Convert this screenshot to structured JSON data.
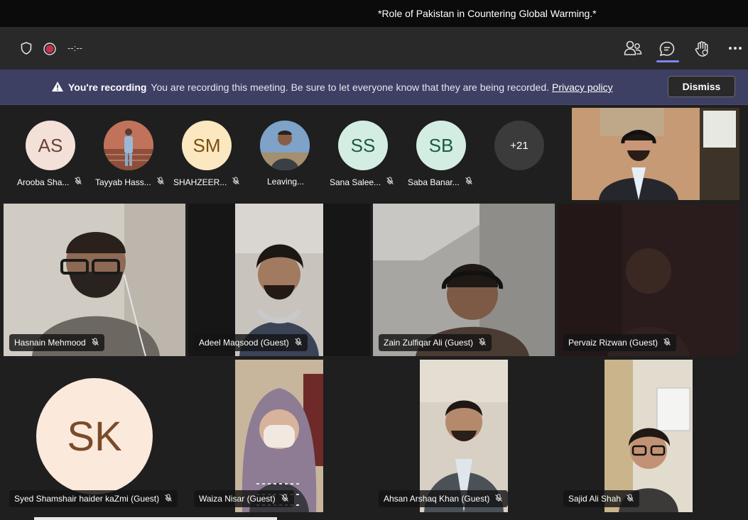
{
  "window": {
    "title": "*Role of Pakistan in Countering Global Warming.*"
  },
  "toolbar": {
    "timer": "--:--",
    "icons": [
      "shield-icon",
      "record-icon",
      "people-icon",
      "chat-icon",
      "raise-hand-icon",
      "more-icon"
    ]
  },
  "banner": {
    "title": "You're recording",
    "message": "You are recording this meeting. Be sure to let everyone know that they are being recorded.",
    "link": "Privacy policy",
    "dismiss": "Dismiss"
  },
  "gallery": [
    {
      "initials": "AS",
      "name": "Arooba Sha...",
      "bg": "#f3e0d9",
      "fg": "#6a4436"
    },
    {
      "initials": "",
      "name": "Tayyab Hass...",
      "bg": "#b9684e",
      "fg": "#ffffff"
    },
    {
      "initials": "SM",
      "name": "SHAHZEER...",
      "bg": "#fce8c0",
      "fg": "#7a4d11"
    },
    {
      "initials": "",
      "name": "Leaving...",
      "bg": "#5d7ea3",
      "fg": "#ffffff"
    },
    {
      "initials": "SS",
      "name": "Sana Salee...",
      "bg": "#d3ede2",
      "fg": "#1d5a42"
    },
    {
      "initials": "SB",
      "name": "Saba Banar...",
      "bg": "#d3ede2",
      "fg": "#1d5a42"
    }
  ],
  "overflow": {
    "label": "+21"
  },
  "tiles": [
    {
      "name": "Hasnain Mehmood"
    },
    {
      "name": "Adeel Maqsood (Guest)"
    },
    {
      "name": "Zain Zulfiqar Ali (Guest)"
    },
    {
      "name": "Pervaiz Rizwan (Guest)"
    },
    {
      "name": "Syed Shamshair haider kaZmi (Guest)",
      "initials": "SK"
    },
    {
      "name": "Waiza Nisar (Guest)"
    },
    {
      "name": "Ahsan Arshaq Khan (Guest)"
    },
    {
      "name": "Sajid Ali Shah"
    }
  ],
  "colors": {
    "accent": "#7f85f5",
    "banner": "#3d3f63",
    "record": "#c4314b"
  }
}
